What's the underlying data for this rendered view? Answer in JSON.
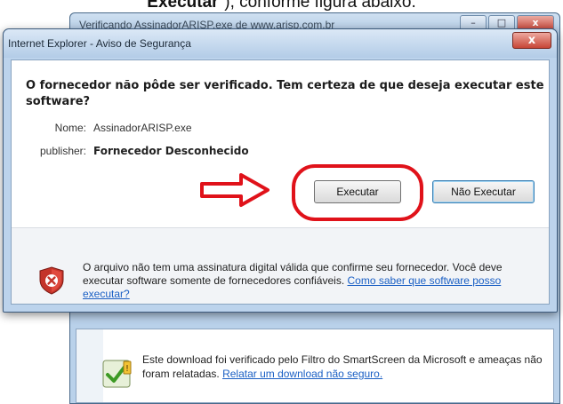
{
  "doc_caption": {
    "bold": "Executar",
    "after": "\"), conforme figura abaixo."
  },
  "background_window": {
    "title": "Verificando AssinadorARISP.exe de www.arisp.com.br",
    "minimize_glyph": "–",
    "maximize_glyph": "□",
    "close_glyph": "x",
    "smartscreen": {
      "text": "Este download foi verificado pelo Filtro do SmartScreen da Microsoft e ameaças não foram relatadas.",
      "link": "Relatar um download não seguro."
    }
  },
  "dialog": {
    "title": "Internet Explorer - Aviso de Segurança",
    "close_glyph": "x",
    "question": "O fornecedor não pôde ser verificado. Tem certeza de que deseja executar este software?",
    "name_label": "Nome:",
    "name_value": "AssinadorARISP.exe",
    "publisher_label": "publisher:",
    "publisher_value": "Fornecedor Desconhecido",
    "run_button": "Executar",
    "dont_run_button": "Não Executar",
    "warning_text": "O arquivo não tem uma assinatura digital válida que confirme seu fornecedor. Você deve executar software somente de fornecedores confiáveis.",
    "warning_link": "Como saber que software posso executar?"
  },
  "colors": {
    "annotation_red": "#e0121a",
    "link_blue": "#1a5fc4",
    "window_frame": "#bcd3ec"
  },
  "icons": {
    "security_shield": "shield-error-icon",
    "smartscreen": "smartscreen-check-icon",
    "annotation_arrow": "red-arrow-icon"
  }
}
